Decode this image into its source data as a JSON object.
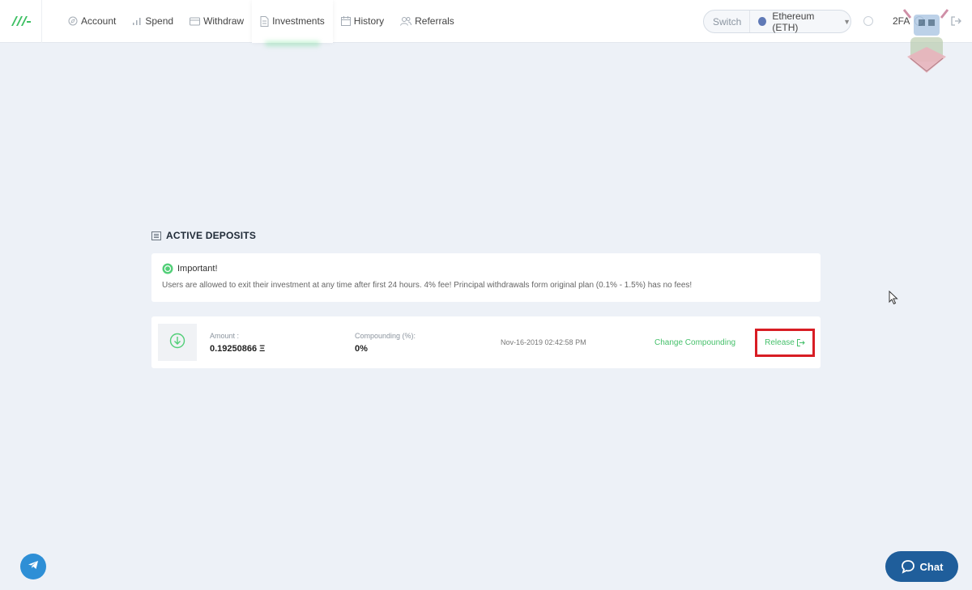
{
  "nav": {
    "items": [
      {
        "label": "Account",
        "icon": "compass-icon"
      },
      {
        "label": "Spend",
        "icon": "bar-chart-icon"
      },
      {
        "label": "Withdraw",
        "icon": "wallet-icon"
      },
      {
        "label": "Investments",
        "icon": "document-icon",
        "active": true
      },
      {
        "label": "History",
        "icon": "calendar-icon"
      },
      {
        "label": "Referrals",
        "icon": "users-icon"
      }
    ]
  },
  "switcher": {
    "label": "Switch",
    "selected": "Ethereum (ETH)"
  },
  "header_right": {
    "twofa": "2FA"
  },
  "section": {
    "title": "ACTIVE DEPOSITS"
  },
  "notice": {
    "heading": "Important!",
    "text": "Users are allowed to exit their investment at any time after first 24 hours. 4% fee! Principal withdrawals form original plan (0.1% - 1.5%) has no fees!"
  },
  "deposit": {
    "amount_label": "Amount :",
    "amount_value": "0.19250866 Ξ",
    "compounding_label": "Compounding (%):",
    "compounding_value": "0%",
    "date": "Nov-16-2019 02:42:58 PM",
    "change_label": "Change Compounding",
    "release_label": "Release"
  },
  "chat": {
    "label": "Chat"
  },
  "colors": {
    "accent_green": "#46c06b",
    "highlight_red": "#d81d24",
    "chat_blue": "#1f5e9b",
    "telegram_blue": "#2e8fd6",
    "background": "#edf1f7"
  }
}
